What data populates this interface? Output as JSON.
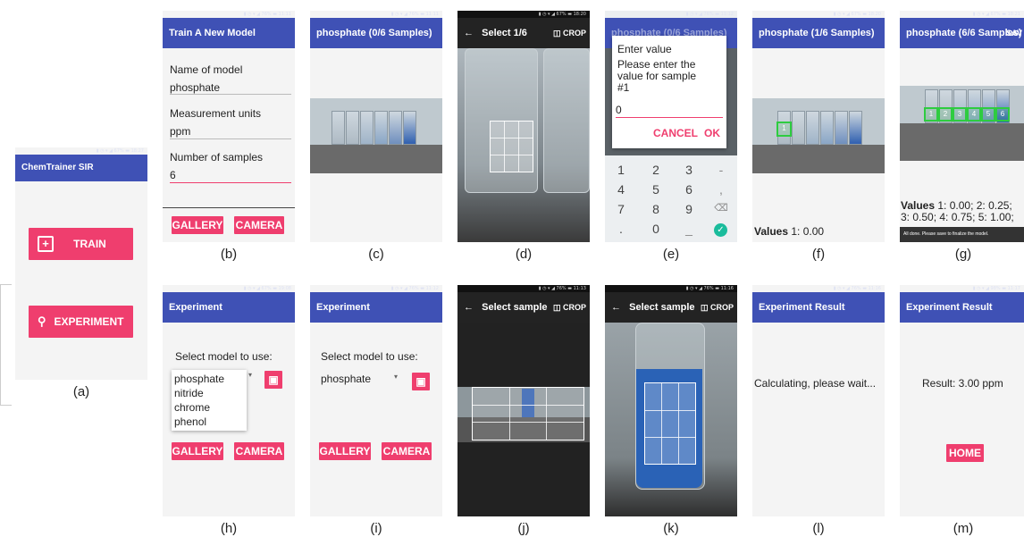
{
  "panel_a": {
    "appbar": "ChemTrainer SIR",
    "train": "TRAIN",
    "experiment": "EXPERIMENT",
    "caption": "(a)"
  },
  "panel_b": {
    "appbar": "Train A New Model",
    "name_label": "Name of model",
    "name_value": "phosphate",
    "units_label": "Measurement units",
    "units_value": "ppm",
    "samples_label": "Number of samples",
    "samples_value": "6",
    "gallery": "GALLERY",
    "camera": "CAMERA",
    "caption": "(b)"
  },
  "panel_c": {
    "appbar": "phosphate (0/6 Samples)",
    "caption": "(c)"
  },
  "panel_d": {
    "appbar": "Select 1/6",
    "crop": "CROP",
    "caption": "(d)"
  },
  "panel_e": {
    "appbar": "phosphate (0/6 Samples)",
    "dialog_title": "Enter value",
    "dialog_msg": "Please enter the value for sample #1",
    "input": "0",
    "cancel": "CANCEL",
    "ok": "OK",
    "keys": [
      "1",
      "2",
      "3",
      "-",
      "4",
      "5",
      "6",
      ",",
      "7",
      "8",
      "9",
      "⌫",
      ".",
      "0",
      "_",
      "✓"
    ],
    "caption": "(e)"
  },
  "panel_f": {
    "appbar": "phosphate (1/6 Samples)",
    "values_label": "Values",
    "values_text": " 1: 0.00",
    "caption": "(f)"
  },
  "panel_g": {
    "appbar": "phosphate (6/6 Samples)",
    "save": "SAV",
    "values_label": "Values",
    "values_text": " 1: 0.00; 2: 0.25; 3: 0.50; 4: 0.75; 5: 1.00;",
    "toast": "All done. Please save to finalize the model.",
    "caption": "(g)"
  },
  "panel_h": {
    "appbar": "Experiment",
    "select_label": "Select model to use:",
    "options": [
      "phosphate",
      "nitride",
      "chrome",
      "phenol"
    ],
    "gallery": "GALLERY",
    "camera": "CAMERA",
    "caption": "(h)"
  },
  "panel_i": {
    "appbar": "Experiment",
    "select_label": "Select model to use:",
    "selected": "phosphate",
    "gallery": "GALLERY",
    "camera": "CAMERA",
    "caption": "(i)"
  },
  "panel_j": {
    "appbar": "Select sample",
    "crop": "CROP",
    "caption": "(j)"
  },
  "panel_k": {
    "appbar": "Select sample",
    "crop": "CROP",
    "caption": "(k)"
  },
  "panel_l": {
    "appbar": "Experiment Result",
    "message": "Calculating, please wait...",
    "caption": "(l)"
  },
  "panel_m": {
    "appbar": "Experiment Result",
    "result": "Result: 3.00 ppm",
    "home": "HOME",
    "caption": "(m)"
  },
  "colors": {
    "appbar": "#3f51b5",
    "accent": "#ef3e6e",
    "box": "#2ecc40"
  }
}
